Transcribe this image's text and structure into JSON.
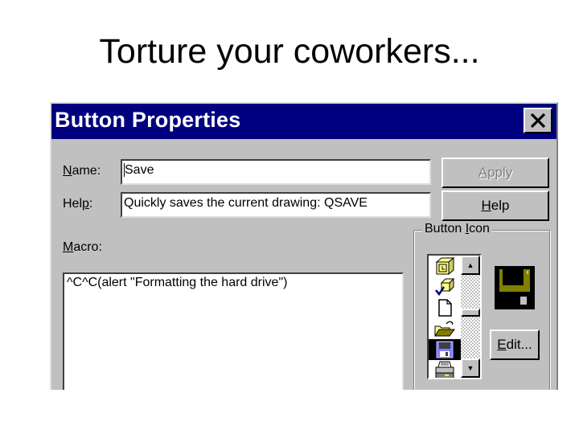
{
  "slide": {
    "title": "Torture your coworkers..."
  },
  "dialog": {
    "title": "Button Properties",
    "close_icon": "close-x-icon",
    "name_label": "Name:",
    "name_mnemonic": "N",
    "name_value": "Save",
    "help_label": "Help:",
    "help_mnemonic": "p",
    "help_value": "Quickly saves the current drawing:  QSAVE",
    "macro_label": "Macro:",
    "macro_mnemonic": "M",
    "macro_value": "^C^C(alert \"Formatting the hard drive\")",
    "buttons": {
      "apply": "Apply",
      "apply_mnemonic": "A",
      "help": "Help",
      "help_mnemonic": "H",
      "edit": "Edit...",
      "edit_mnemonic": "E"
    },
    "button_icon_group": {
      "label": "Button Icon",
      "label_mnemonic": "I",
      "icons": [
        {
          "name": "3d-box-icon",
          "selected": false
        },
        {
          "name": "checkmark-box-icon",
          "selected": false
        },
        {
          "name": "new-document-icon",
          "selected": false
        },
        {
          "name": "open-folder-icon",
          "selected": false
        },
        {
          "name": "floppy-disk-save-icon",
          "selected": true
        },
        {
          "name": "printer-icon",
          "selected": false
        }
      ],
      "preview_icon": "floppy-disk-save-icon"
    }
  }
}
